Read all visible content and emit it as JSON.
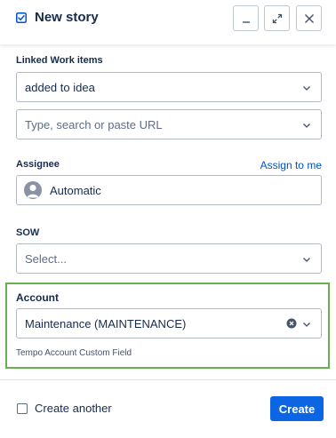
{
  "header": {
    "title": "New story",
    "icons": [
      "story-checkbox-icon",
      "minimize-icon",
      "expand-icon",
      "close-icon"
    ]
  },
  "linked_work_items": {
    "label": "Linked Work items",
    "relation_value": "added to idea",
    "search_placeholder": "Type, search or paste URL"
  },
  "assignee": {
    "label": "Assignee",
    "assign_link": "Assign to me",
    "value": "Automatic"
  },
  "sow": {
    "label": "SOW",
    "placeholder": "Select..."
  },
  "account": {
    "label": "Account",
    "value": "Maintenance (MAINTENANCE)",
    "description": "Tempo Account Custom Field"
  },
  "footer": {
    "create_another_label": "Create another",
    "create_another_checked": false,
    "create_label": "Create"
  },
  "colors": {
    "accent": "#0c66e4",
    "link": "#0052cc",
    "highlight_border": "#6ab04c",
    "text": "#172b4d"
  }
}
